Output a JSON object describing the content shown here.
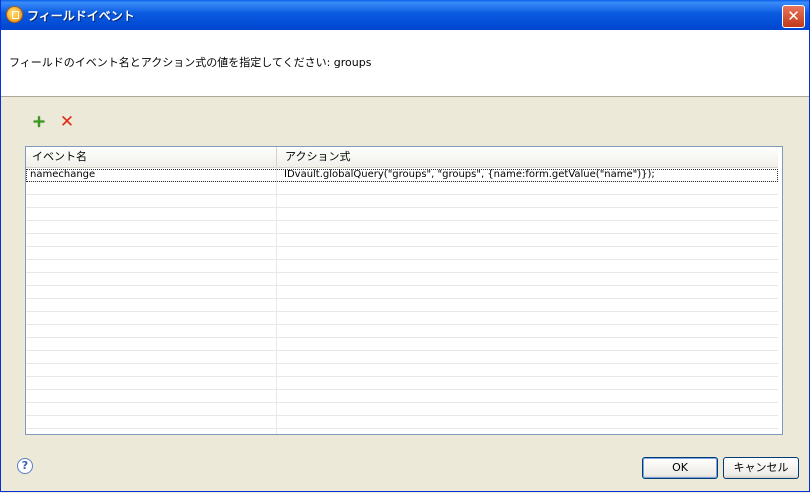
{
  "window": {
    "title": "フィールドイベント"
  },
  "banner": {
    "message": "フィールドのイベント名とアクション式の値を指定してください: groups"
  },
  "toolbar": {
    "add_icon": "+",
    "remove_icon": "✕"
  },
  "table": {
    "columns": [
      "イベント名",
      "アクション式"
    ],
    "rows": [
      {
        "event": "namechange",
        "action": "IDvault.globalQuery(\"groups\", \"groups\", {name:form.getValue(\"name\")});"
      }
    ]
  },
  "footer": {
    "help_icon": "?",
    "ok_label": "OK",
    "cancel_label": "キャンセル"
  }
}
